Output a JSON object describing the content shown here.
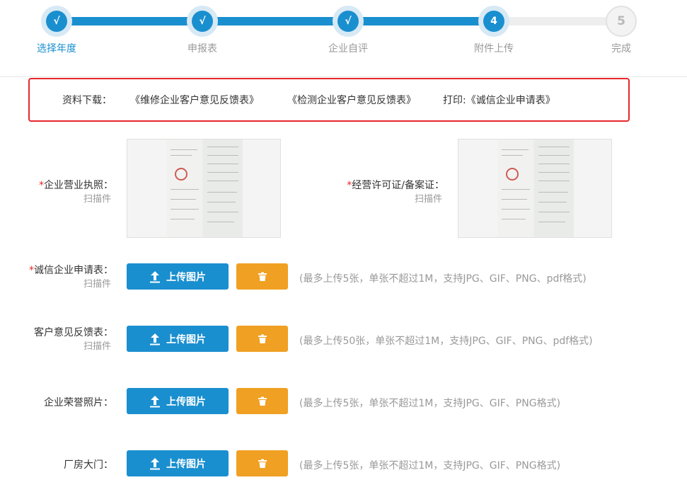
{
  "stepper": {
    "steps": [
      {
        "label": "选择年度",
        "marker": "√",
        "state": "done"
      },
      {
        "label": "申报表",
        "marker": "√",
        "state": "done"
      },
      {
        "label": "企业自评",
        "marker": "√",
        "state": "done"
      },
      {
        "label": "附件上传",
        "marker": "4",
        "state": "current"
      },
      {
        "label": "完成",
        "marker": "5",
        "state": "todo"
      }
    ]
  },
  "downloads": {
    "label": "资料下载：",
    "links": [
      "《维修企业客户意见反馈表》",
      "《检测企业客户意见反馈表》",
      "打印:《诚信企业申请表》"
    ]
  },
  "fields": {
    "business_license": {
      "label": "企业营业执照：",
      "sub": "扫描件",
      "required_mark": "*"
    },
    "operating_permit": {
      "label": "经营许可证/备案证：",
      "sub": "扫描件",
      "required_mark": "*"
    },
    "integrity_application": {
      "label": "诚信企业申请表：",
      "sub": "扫描件",
      "required_mark": "*",
      "hint": "(最多上传5张，单张不超过1M，支持JPG、GIF、PNG、pdf格式)"
    },
    "customer_feedback": {
      "label": "客户意见反馈表：",
      "sub": "扫描件",
      "hint": "(最多上传50张，单张不超过1M，支持JPG、GIF、PNG、pdf格式)"
    },
    "honor_photos": {
      "label": "企业荣誉照片：",
      "hint": "(最多上传5张，单张不超过1M，支持JPG、GIF、PNG格式)"
    },
    "factory_gate": {
      "label": "厂房大门：",
      "hint": "(最多上传5张，单张不超过1M，支持JPG、GIF、PNG格式)"
    }
  },
  "buttons": {
    "upload_label": "上传图片"
  },
  "colors": {
    "primary": "#1a8fcf",
    "warning": "#f0a022",
    "required": "#e8262b",
    "highlight_border": "#e8262b"
  },
  "icons": {
    "upload": "upload-arrow-icon",
    "delete": "trash-icon"
  }
}
